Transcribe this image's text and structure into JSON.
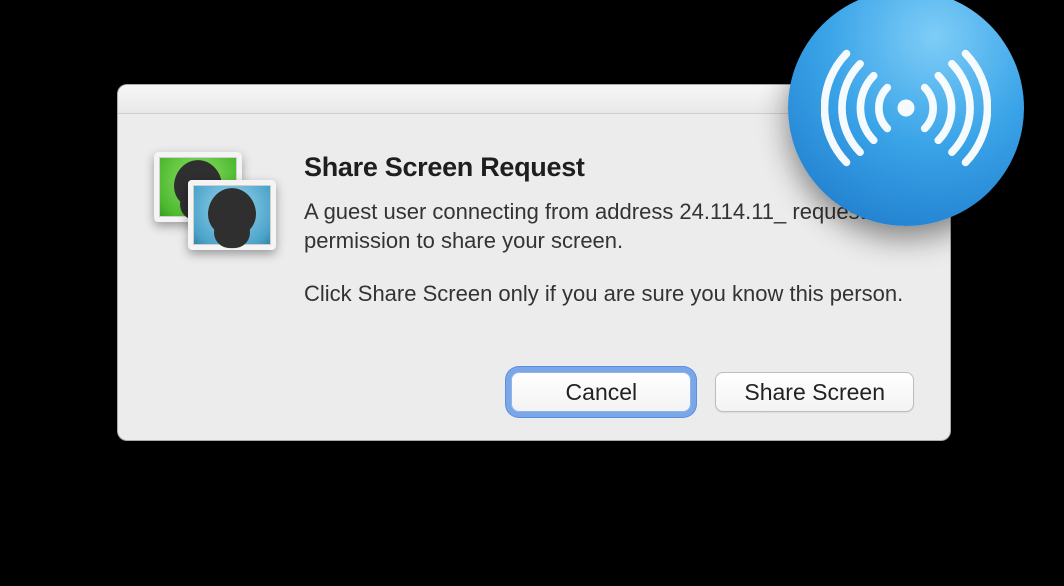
{
  "dialog": {
    "title": "Share Screen Request",
    "line1": "A guest user connecting from address 24.114.11_ requesting permission to share your screen.",
    "line2": "Click Share Screen only if you are sure you know this person.",
    "cancel_label": "Cancel",
    "share_label": "Share Screen"
  },
  "icons": {
    "app_icon": "screen-sharing-icon",
    "overlay_icon": "airdrop-broadcast-icon"
  },
  "colors": {
    "focus_ring": "#7aa7e8",
    "airdrop_blue": "#2d91dc",
    "dialog_bg": "#ececec"
  }
}
